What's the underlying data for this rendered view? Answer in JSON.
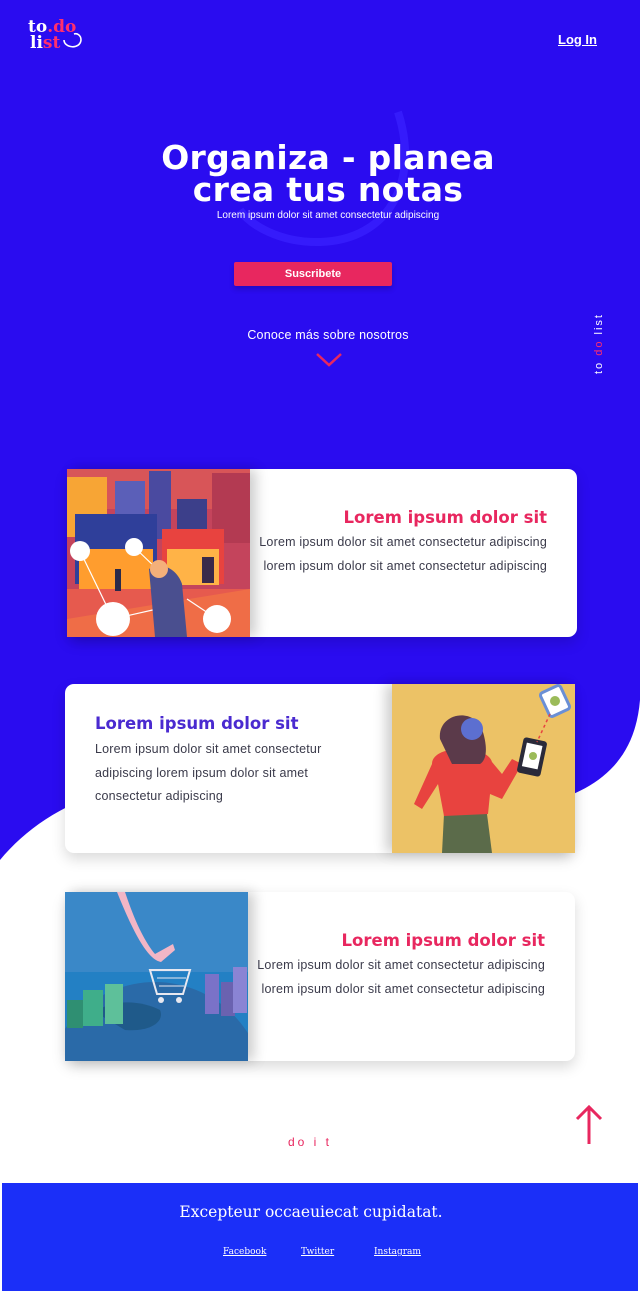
{
  "colors": {
    "primary_blue": "#2a0cf0",
    "accent_pink": "#e8275f",
    "title_purple": "#4a2ad0",
    "footer_blue": "#1b2ff8"
  },
  "header": {
    "logo_line1_a": "to",
    "logo_line1_b": ".do",
    "logo_line2_a": "li",
    "logo_line2_b": "st",
    "login_label": "Log In"
  },
  "hero": {
    "title_line1": "Organiza - planea",
    "title_line2": "crea tus notas",
    "subtitle": "Lorem ipsum dolor sit amet consectetur adipiscing",
    "cta_label": "Suscribete",
    "know_more": "Conoce más sobre nosotros",
    "side_tag_a": "to ",
    "side_tag_b": "do",
    "side_tag_c": " list"
  },
  "cards": [
    {
      "title": "Lorem ipsum dolor sit",
      "text": "Lorem ipsum dolor sit amet consectetur adipiscing lorem ipsum dolor sit amet consectetur adipiscing",
      "image": "city-shopping-illustration"
    },
    {
      "title": "Lorem ipsum dolor sit",
      "text": "Lorem ipsum dolor sit amet consectetur adipiscing lorem ipsum dolor sit amet consectetur adipiscing",
      "image": "woman-phone-illustration"
    },
    {
      "title": "Lorem ipsum dolor sit",
      "text": "Lorem ipsum dolor sit amet consectetur adipiscing lorem ipsum dolor sit amet consectetur adipiscing",
      "image": "globe-cart-illustration"
    }
  ],
  "doit_label": "do  i t",
  "icons": {
    "scroll_down": "chevron-down-icon",
    "back_to_top": "arrow-up-icon"
  },
  "footer": {
    "title": "Excepteur occaeuiecat cupidatat.",
    "links": [
      "Facebook",
      "Twitter",
      "Instagram"
    ]
  }
}
